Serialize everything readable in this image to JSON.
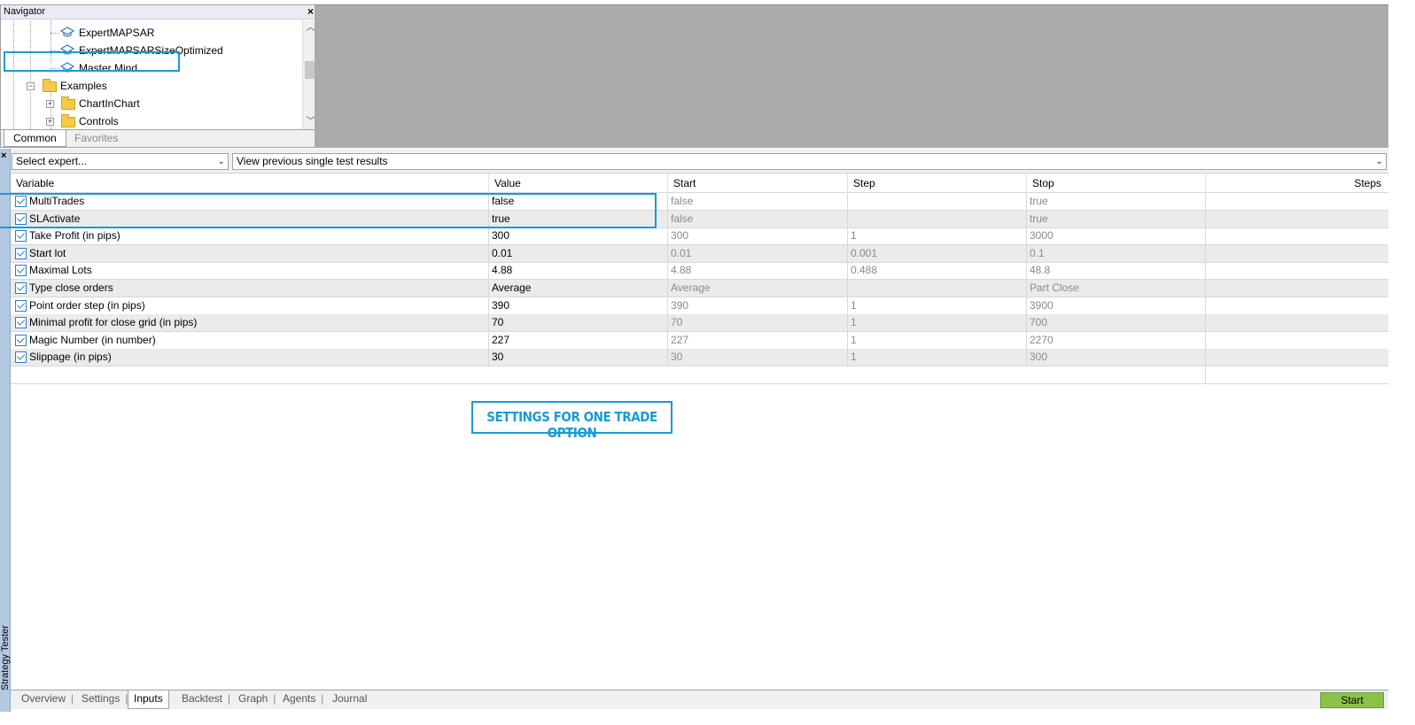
{
  "navigator": {
    "title": "Navigator",
    "close": "×",
    "tree": [
      {
        "label": "ExpertMAPSAR",
        "icon": "expert-hat-icon"
      },
      {
        "label": "ExpertMAPSARSizeOptimized",
        "icon": "expert-hat-icon"
      },
      {
        "label": "Master Mind",
        "icon": "expert-hat-icon"
      },
      {
        "label": "Examples",
        "icon": "folder-icon"
      },
      {
        "label": "ChartInChart",
        "icon": "folder-icon"
      },
      {
        "label": "Controls",
        "icon": "folder-icon"
      }
    ],
    "tabs": [
      "Common",
      "Favorites"
    ]
  },
  "tester": {
    "side_label": "Strategy Tester",
    "close": "×",
    "expert_select": "Select expert...",
    "results_select": "View previous single test results",
    "columns": [
      "Variable",
      "Value",
      "Start",
      "Step",
      "Stop",
      "Steps"
    ],
    "rows": [
      {
        "variable": "MultiTrades",
        "value": "false",
        "start": "false",
        "step": "",
        "stop": "true",
        "steps": ""
      },
      {
        "variable": "SLActivate",
        "value": "true",
        "start": "false",
        "step": "",
        "stop": "true",
        "steps": ""
      },
      {
        "variable": "Take Profit (in pips)",
        "value": "300",
        "start": "300",
        "step": "1",
        "stop": "3000",
        "steps": ""
      },
      {
        "variable": "Start lot",
        "value": "0.01",
        "start": "0.01",
        "step": "0.001",
        "stop": "0.1",
        "steps": ""
      },
      {
        "variable": "Maximal Lots",
        "value": "4.88",
        "start": "4.88",
        "step": "0.488",
        "stop": "48.8",
        "steps": ""
      },
      {
        "variable": "Type close orders",
        "value": "Average",
        "start": "Average",
        "step": "",
        "stop": "Part Close",
        "steps": ""
      },
      {
        "variable": "Point order step (in pips)",
        "value": "390",
        "start": "390",
        "step": "1",
        "stop": "3900",
        "steps": ""
      },
      {
        "variable": "Minimal profit for close grid (in pips)",
        "value": "70",
        "start": "70",
        "step": "1",
        "stop": "700",
        "steps": ""
      },
      {
        "variable": "Magic Number (in number)",
        "value": "227",
        "start": "227",
        "step": "1",
        "stop": "2270",
        "steps": ""
      },
      {
        "variable": "Slippage (in pips)",
        "value": "30",
        "start": "30",
        "step": "1",
        "stop": "300",
        "steps": ""
      }
    ],
    "note": "SETTINGS FOR ONE TRADE OPTION",
    "bottom_tabs": [
      "Overview",
      "Settings",
      "Inputs",
      "Backtest",
      "Graph",
      "Agents",
      "Journal"
    ],
    "active_tab": "Inputs",
    "start_button": "Start"
  },
  "colors": {
    "highlight": "#1a9ad6",
    "start_button": "#8bc34a",
    "gray_area": "#ababab"
  }
}
